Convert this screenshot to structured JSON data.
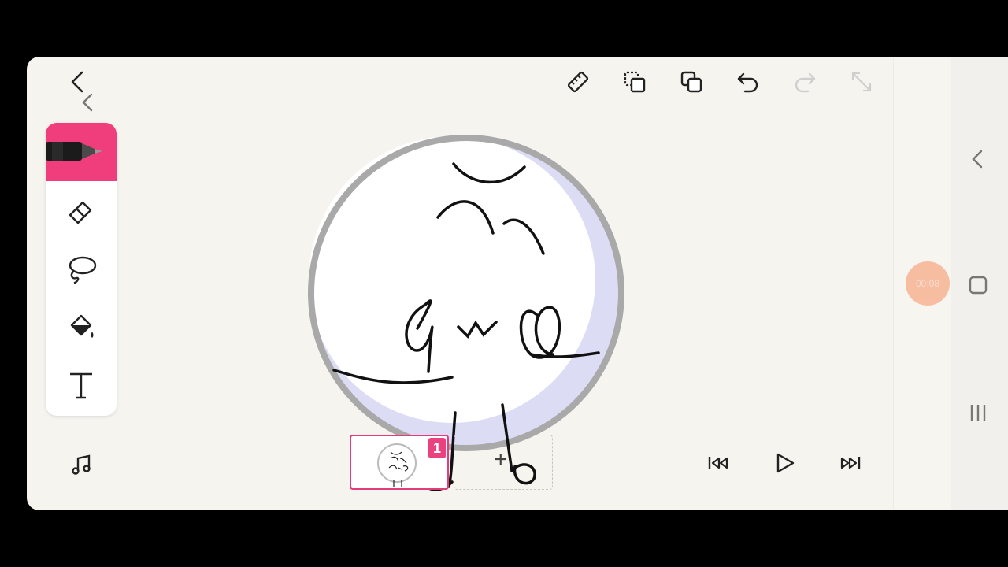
{
  "toolbar": {
    "back_icon": "chevron-left-icon",
    "ruler_icon": "ruler-icon",
    "select_frame_icon": "select-copy-icon",
    "duplicate_icon": "duplicate-icon",
    "undo_icon": "undo-icon",
    "redo_icon": "redo-icon",
    "fullscreen_icon": "expand-icon",
    "menu_icon": "more-vertical-icon"
  },
  "tools": [
    "pen",
    "eraser",
    "lasso",
    "fill-bucket",
    "text"
  ],
  "timeline": {
    "current_frame_number": "1",
    "add_frame_label": "+",
    "music_icon": "music-note-icon",
    "playback": [
      "skip-to-start-icon",
      "play-icon",
      "skip-to-end-icon",
      "layers-icon"
    ],
    "layers_count": "1"
  },
  "recorder": {
    "timer_text": "00:08"
  },
  "colors": {
    "accent": "#f03d7b",
    "badge": "#e9427f",
    "canvas_bg": "#f6f4ef",
    "circle_stroke": "#a9a9a9",
    "circle_shade": "#dcdcf5"
  }
}
